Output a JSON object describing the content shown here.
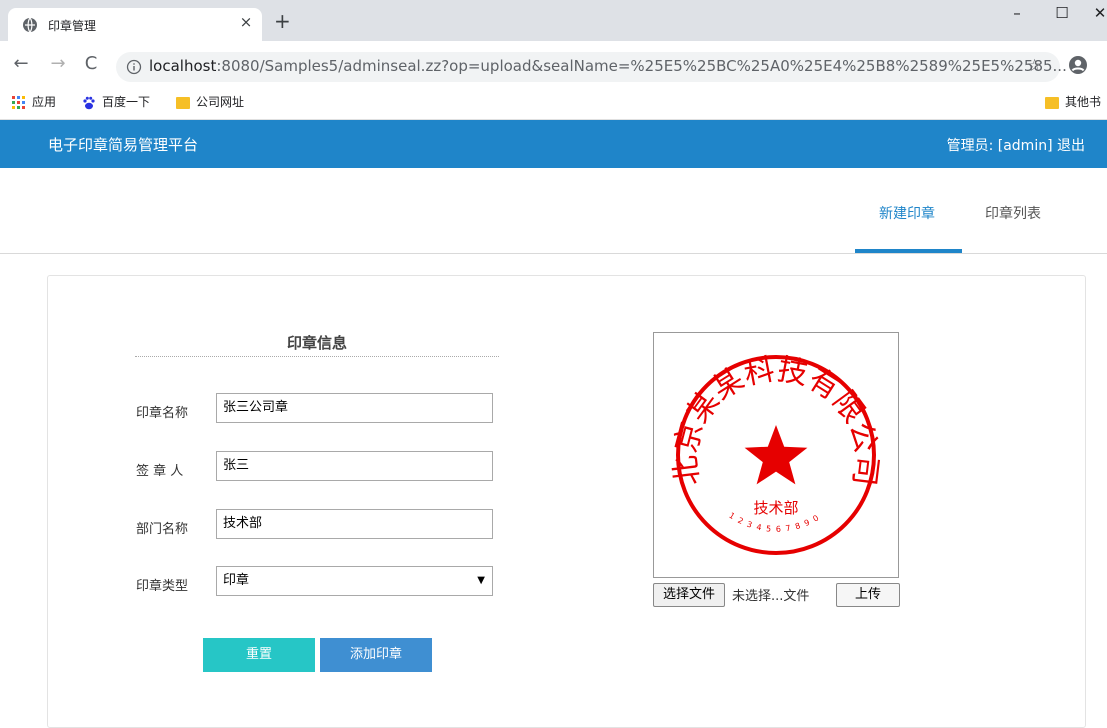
{
  "browser": {
    "tab_title": "印章管理",
    "tab_close": "×",
    "new_tab": "+",
    "url_host": "localhost",
    "url_rest": ":8080/Samples5/adminseal.zz?op=upload&sealName=%25E5%25BC%25A0%25E4%25B8%2589%25E5%2585...",
    "minimize": "–",
    "maximize": "☐",
    "close": "✕",
    "bookmarks": {
      "apps": "应用",
      "baidu": "百度一下",
      "company": "公司网址",
      "other": "其他书"
    }
  },
  "header": {
    "app_title": "电子印章简易管理平台",
    "admin_prefix": "管理员: ",
    "admin_name": "[admin]",
    "logout": "退出"
  },
  "nav": {
    "tabs": [
      {
        "label": "新建印章",
        "active": true
      },
      {
        "label": "印章列表",
        "active": false
      }
    ]
  },
  "form": {
    "section_title": "印章信息",
    "fields": {
      "seal_name": {
        "label": "印章名称",
        "value": "张三公司章"
      },
      "signer": {
        "label": "签 章 人",
        "value": "张三"
      },
      "department": {
        "label": "部门名称",
        "value": "技术部"
      },
      "seal_type": {
        "label": "印章类型",
        "value": "印章"
      }
    },
    "reset_label": "重置",
    "add_label": "添加印章"
  },
  "seal": {
    "arc_text": "北京某某科技有限公司",
    "center_text": "技术部",
    "serial": "1234567890",
    "color": "#e60000"
  },
  "upload": {
    "choose_label": "选择文件",
    "status_text": "未选择...文件",
    "upload_label": "上传"
  },
  "colors": {
    "header_bg": "#1f85c9",
    "reset_bg": "#26c6c6",
    "add_bg": "#3f8fd2"
  }
}
